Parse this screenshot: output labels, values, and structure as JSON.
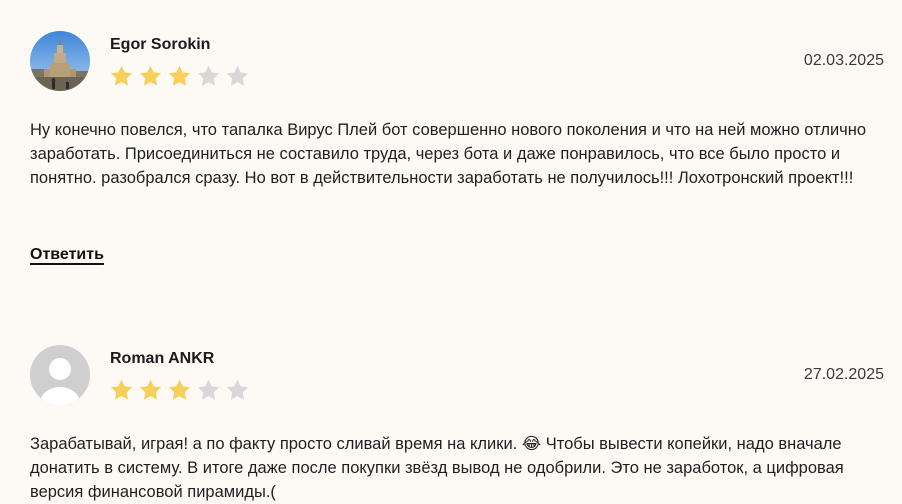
{
  "reviews": [
    {
      "author": "Egor Sorokin",
      "date": "02.03.2025",
      "rating": 3,
      "rating_max": 5,
      "text": "Ну конечно повелся, что тапалка Вирус Плей бот совершенно нового поколения и что на ней можно отлично заработать. Присоединиться не составило труда, через бота и даже понравилось, что все было просто и понятно. разобрался сразу. Но вот в действительности заработать не получилось!!! Лохотронский проект!!!",
      "reply_label": "Ответить",
      "avatar": "photo-avatar"
    },
    {
      "author": "Roman ANKR",
      "date": "27.02.2025",
      "rating": 3,
      "rating_max": 5,
      "text": "Зарабатывай, играя! а по факту просто сливай время на клики. 😂 Чтобы вывести копейки, надо вначале донатить в систему. В итоге даже после покупки звёзд вывод не одобрили. Это не заработок, а цифровая версия финансовой пирамиды.(",
      "avatar": "default-user-avatar"
    }
  ],
  "colors": {
    "background": "#fdf9f5",
    "star_filled": "#f7d05c",
    "star_empty": "#d8d8d8",
    "default_avatar_bg": "#cfcfcf"
  }
}
